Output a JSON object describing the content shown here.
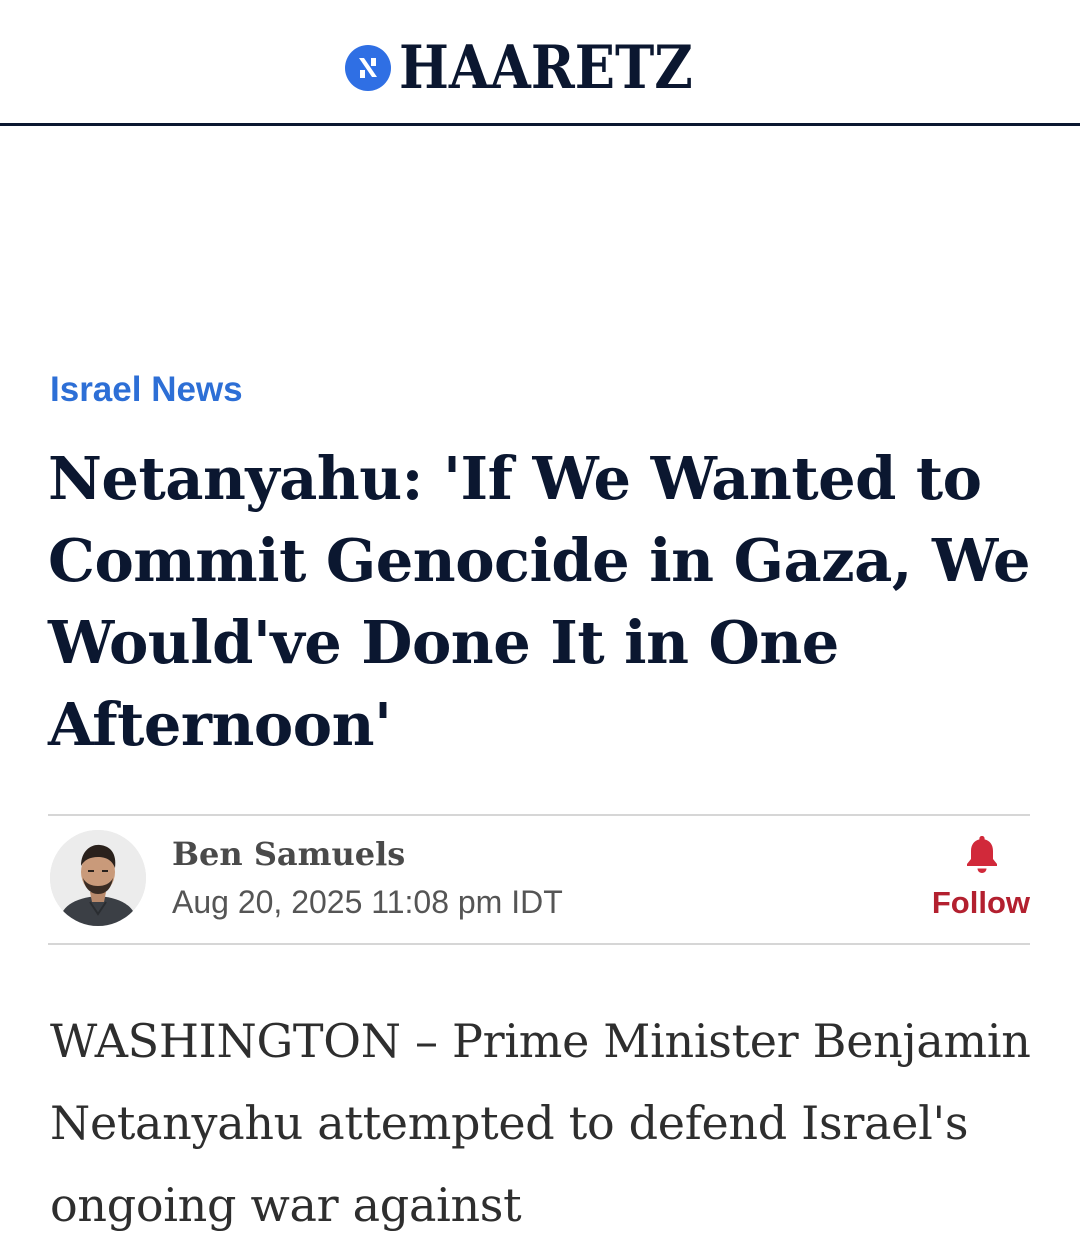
{
  "header": {
    "brand_name": "HAARETZ"
  },
  "article": {
    "section": "Israel News",
    "headline": "Netanyahu: 'If We Wanted to Commit Genocide in Gaza, We Would've Done It in One Afternoon'",
    "author": {
      "name": "Ben Samuels",
      "date": "Aug 20, 2025 11:08 pm IDT"
    },
    "follow_label": "Follow",
    "lead_paragraph": "WASHINGTON – Prime Minister Benjamin Netanyahu attempted to defend Israel's ongoing war against"
  },
  "colors": {
    "brand_navy": "#0b1730",
    "badge_blue": "#2f6fe4",
    "section_blue": "#2d6fd6",
    "follow_red": "#b3202f"
  },
  "icons": {
    "logo": "haaretz-logo-icon",
    "follow": "bell-icon"
  }
}
